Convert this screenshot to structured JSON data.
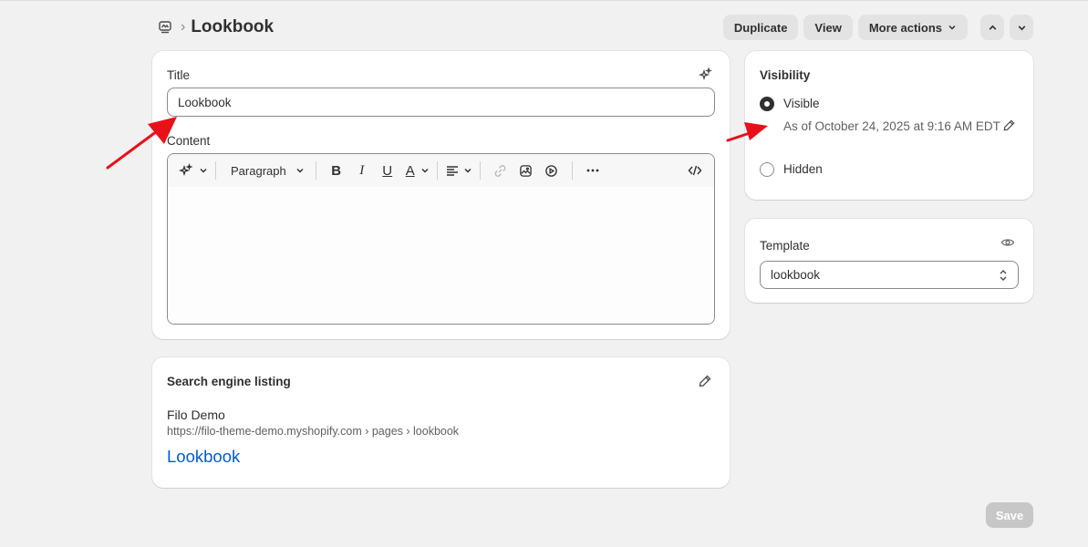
{
  "header": {
    "title": "Lookbook",
    "breadcrumb_separator": "›",
    "breadcrumb_icon": "pages-icon",
    "actions": {
      "duplicate": "Duplicate",
      "view": "View",
      "more_actions": "More actions"
    }
  },
  "main_card": {
    "title_label": "Title",
    "title_value": "Lookbook",
    "content_label": "Content",
    "toolbar": {
      "paragraph": "Paragraph",
      "bold": "B",
      "italic": "I",
      "underline": "U",
      "text_color": "A"
    }
  },
  "seo": {
    "heading": "Search engine listing",
    "store_name": "Filo Demo",
    "url": "https://filo-theme-demo.myshopify.com › pages › lookbook",
    "link_title": "Lookbook"
  },
  "visibility": {
    "heading": "Visibility",
    "options": [
      {
        "label": "Visible",
        "selected": true
      },
      {
        "label": "Hidden",
        "selected": false
      }
    ],
    "note": "As of October 24, 2025 at 9:16 AM EDT"
  },
  "template": {
    "label": "Template",
    "selected": "lookbook"
  },
  "footer": {
    "save_label": "Save"
  },
  "colors": {
    "background": "#f1f1f1",
    "link": "#005bd3",
    "annotation_arrow": "#e8111a",
    "save_disabled": "#c7c7c7"
  }
}
